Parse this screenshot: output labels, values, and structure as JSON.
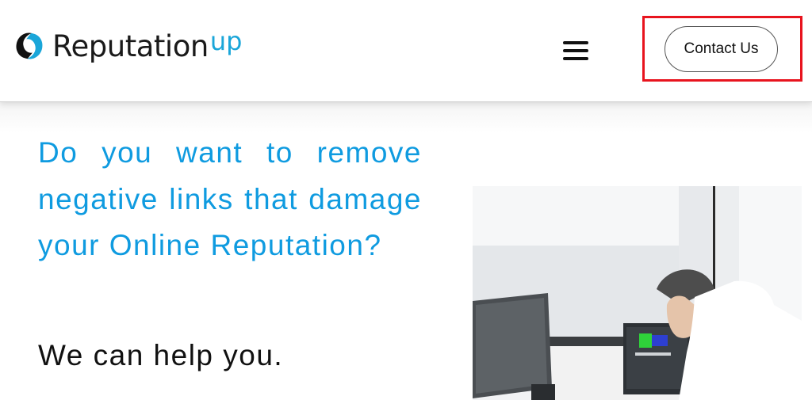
{
  "header": {
    "logo": {
      "word": "Reputation",
      "suffix": "up",
      "brand_color": "#1aa6d9"
    },
    "menu_icon": "hamburger-menu-icon",
    "contact_button_label": "Contact Us",
    "highlight_color": "#e8141e"
  },
  "hero": {
    "headline": "Do you want to remove negative links that damage your Online Reputation?",
    "subheadline": "We can help you.",
    "headline_color": "#0f9be0",
    "image_description": "Man in white shirt looking at computer monitors in an office"
  }
}
